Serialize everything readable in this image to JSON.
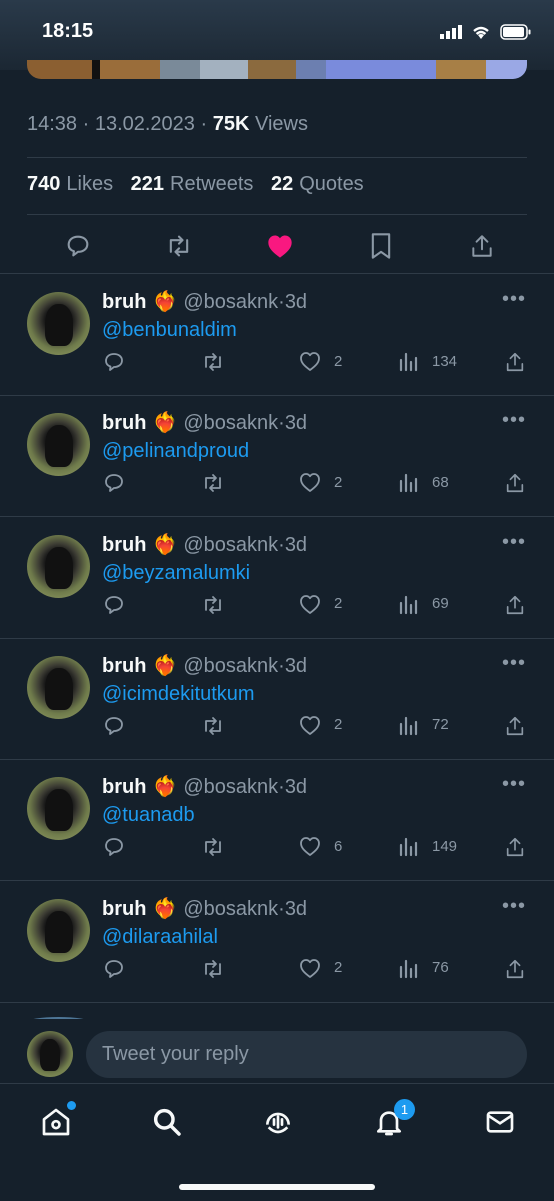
{
  "status_bar": {
    "time": "18:15"
  },
  "tweet_meta": {
    "time_date": "14:38 · 13.02.2023 · ",
    "views_count": "75K",
    "views_label": "Views"
  },
  "engagement": {
    "likes_count": "740",
    "likes_label": "Likes",
    "retweets_count": "221",
    "retweets_label": "Retweets",
    "quotes_count": "22",
    "quotes_label": "Quotes"
  },
  "replies": [
    {
      "name": "bruh",
      "emoji": "❤️‍🔥",
      "handle": "@bosaknk",
      "dot": "·",
      "time": "3d",
      "text": "@benbunaldim",
      "likes": "2",
      "views": "134"
    },
    {
      "name": "bruh",
      "emoji": "❤️‍🔥",
      "handle": "@bosaknk",
      "dot": "·",
      "time": "3d",
      "text": "@pelinandproud",
      "likes": "2",
      "views": "68"
    },
    {
      "name": "bruh",
      "emoji": "❤️‍🔥",
      "handle": "@bosaknk",
      "dot": "·",
      "time": "3d",
      "text": "@beyzamalumki",
      "likes": "2",
      "views": "69"
    },
    {
      "name": "bruh",
      "emoji": "❤️‍🔥",
      "handle": "@bosaknk",
      "dot": "·",
      "time": "3d",
      "text": "@icimdekitutkum",
      "likes": "2",
      "views": "72"
    },
    {
      "name": "bruh",
      "emoji": "❤️‍🔥",
      "handle": "@bosaknk",
      "dot": "·",
      "time": "3d",
      "text": "@tuanadb",
      "likes": "6",
      "views": "149"
    },
    {
      "name": "bruh",
      "emoji": "❤️‍🔥",
      "handle": "@bosaknk",
      "dot": "·",
      "time": "3d",
      "text": "@dilaraahilal",
      "likes": "2",
      "views": "76"
    }
  ],
  "reply_bar": {
    "placeholder": "Tweet your reply"
  },
  "tab_bar": {
    "notifications_badge": "1"
  },
  "colors": {
    "background": "#15202b",
    "accent": "#1d9bf0",
    "like": "#f91880"
  }
}
